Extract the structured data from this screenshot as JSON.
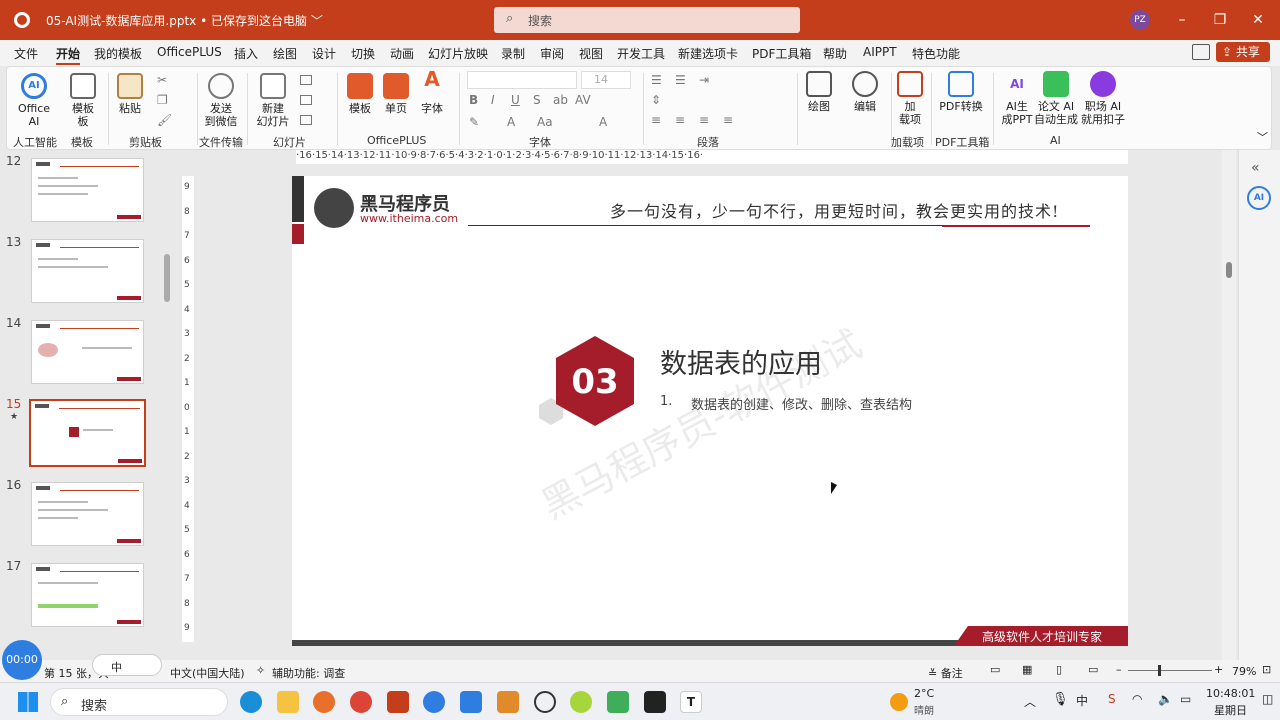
{
  "titlebar": {
    "filename": "05-AI测试-数据库应用.pptx",
    "saved": "• 已保存到这台电脑 ﹀",
    "search_placeholder": "搜索",
    "avatar": "PZ"
  },
  "tabs": [
    "文件",
    "开始",
    "我的模板",
    "OfficePLUS",
    "插入",
    "绘图",
    "设计",
    "切换",
    "动画",
    "幻灯片放映",
    "录制",
    "审阅",
    "视图",
    "开发工具",
    "新建选项卡",
    "PDF工具箱",
    "帮助",
    "AIPPT",
    "特色功能"
  ],
  "share_label": "共享",
  "ribbon": {
    "office_ai": "Office\nAI",
    "template": "模板\n板",
    "paste": "粘贴",
    "send_wechat": "发送\n到微信",
    "new_slide": "新建\n幻灯片",
    "tpl": "模板",
    "single_page": "单页",
    "font_btn": "字体",
    "drawing": "绘图",
    "editing": "编辑",
    "addin": "加\n载项",
    "pdf_convert": "PDF转换",
    "ai_ppt": "AI生\n成PPT",
    "paper_ai": "论文 AI\n自动生成",
    "job_ai": "职场 AI\n就用扣子",
    "font_size": "14",
    "groups": {
      "ai": "人工智能",
      "tpl": "模板",
      "clipboard": "剪贴板",
      "transfer": "文件传输",
      "slides": "幻灯片",
      "officeplus": "OfficePLUS",
      "font": "字体",
      "paragraph": "段落",
      "addins": "加载项",
      "pdf": "PDF工具箱",
      "ai2": "AI"
    }
  },
  "thumbs": [
    {
      "num": "12"
    },
    {
      "num": "13"
    },
    {
      "num": "14"
    },
    {
      "num": "15",
      "star": "★"
    },
    {
      "num": "16"
    },
    {
      "num": "17"
    }
  ],
  "ruler_top": "·16·15·14·13·12·11·10·9·8·7·6·5·4·3·2·1·0·1·2·3·4·5·6·7·8·9·10·11·12·13·14·15·16·",
  "ruler_left": [
    "9",
    "8",
    "7",
    "6",
    "5",
    "4",
    "3",
    "2",
    "1",
    "0",
    "1",
    "2",
    "3",
    "4",
    "5",
    "6",
    "7",
    "8",
    "9"
  ],
  "slide": {
    "logo_cn": "黑马程序员",
    "logo_url": "www.itheima.com",
    "slogan": "多一句没有，少一句不行，用更短时间，教会更实用的技术!",
    "section_num": "03",
    "title": "数据表的应用",
    "bullet_num": "1.",
    "bullet_text": "数据表的创建、修改、删除、查表结构",
    "watermark": "黑马程序员-软件测试",
    "footer": "高级软件人才培训专家"
  },
  "status": {
    "slide_info": "第 15 张，共",
    "lang": "中文(中国大陆)",
    "accessibility": "辅助功能: 调查",
    "notes": "备注",
    "zoom": "79%",
    "ime": "中",
    "timer": "00:00"
  },
  "taskbar": {
    "search": "搜索",
    "weather_temp": "2°C",
    "weather_desc": "晴朗",
    "time": "10:48:01",
    "day": "星期日"
  },
  "colors": {
    "accent": "#c43e1c",
    "brand_red": "#a51c2b"
  }
}
